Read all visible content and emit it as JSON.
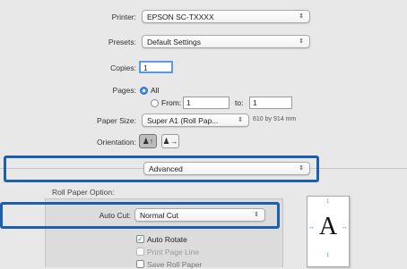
{
  "printer": {
    "label": "Printer:",
    "value": "EPSON SC-TXXXX"
  },
  "presets": {
    "label": "Presets:",
    "value": "Default Settings"
  },
  "copies": {
    "label": "Copies:",
    "value": "1"
  },
  "pages": {
    "label": "Pages:",
    "all_label": "All",
    "from_label": "From:",
    "from_value": "1",
    "to_label": "to:",
    "to_value": "1"
  },
  "paper_size": {
    "label": "Paper Size:",
    "value": "Super A1 (Roll Pap...",
    "dimensions": "610 by 914 mm"
  },
  "orientation": {
    "label": "Orientation:"
  },
  "panel": {
    "value": "Advanced"
  },
  "roll_paper": {
    "section_label": "Roll Paper Option:",
    "auto_cut_label": "Auto Cut:",
    "auto_cut_value": "Normal Cut",
    "auto_rotate_label": "Auto Rotate",
    "print_page_line_label": "Print Page Line",
    "third_option_label": "Save Roll Paper"
  },
  "preview": {
    "letter": "A"
  },
  "colors": {
    "highlight": "#1c5fae",
    "accent": "#3d8be6"
  }
}
